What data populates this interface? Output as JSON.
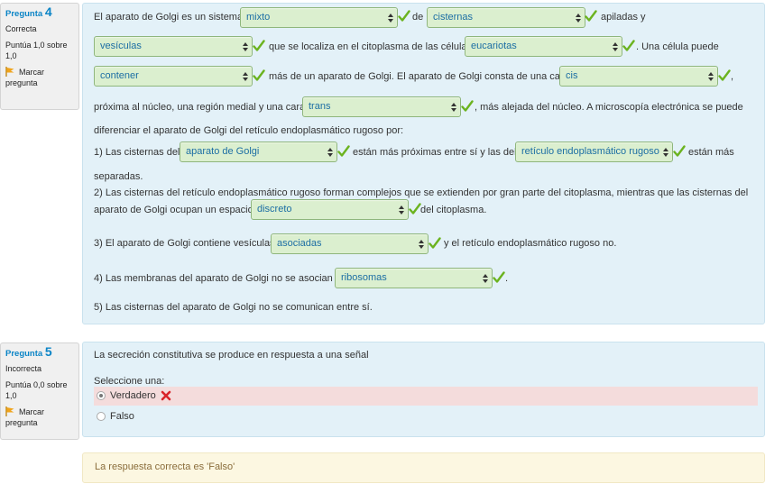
{
  "q4": {
    "number_prefix": "Pregunta",
    "number": "4",
    "state": "Correcta",
    "grade": "Puntúa 1,0 sobre 1,0",
    "flag_label": "Marcar pregunta",
    "text": {
      "t1": "El aparato de Golgi es un sistema",
      "t2": "de",
      "t3": "apiladas y",
      "t4": "que se localiza en el citoplasma de las células",
      "t5": ". Una célula puede",
      "t6": "más de un aparato de Golgi. El aparato de Golgi consta de una cara",
      "t7": ",",
      "t8": "próxima al núcleo, una región medial y una cara",
      "t9": ", más alejada del núcleo. A microscopía electrónica se puede",
      "t10": "diferenciar el aparato de Golgi del retículo endoplasmático rugoso por:",
      "t11": "1) Las cisternas del",
      "t12": "están más próximas entre sí y las del",
      "t13": "están más",
      "t14": "separadas.",
      "t15": "2) Las cisternas del retículo endoplasmático rugoso forman complejos que se extienden por gran parte del citoplasma, mientras que las cisternas del",
      "t16": "aparato de Golgi ocupan un espacio",
      "t17": "del citoplasma.",
      "t18": "3) El aparato de Golgi contiene vesículas",
      "t19": "y el retículo endoplasmático rugoso no.",
      "t20": "4) Las membranas del aparato de Golgi no se asocian a",
      "t21": ".",
      "t22": "5) Las cisternas del aparato de Golgi no se comunican entre sí."
    },
    "selects": {
      "s1": "mixto",
      "s2": "cisternas",
      "s3": "vesículas",
      "s4": "eucariotas",
      "s5": "contener",
      "s6": "cis",
      "s7": "trans",
      "s8": "aparato de Golgi",
      "s9": "retículo endoplasmático rugoso",
      "s10": "discreto",
      "s11": "asociadas",
      "s12": "ribosomas"
    }
  },
  "q5": {
    "number_prefix": "Pregunta",
    "number": "5",
    "state": "Incorrecta",
    "grade": "Puntúa 0,0 sobre 1,0",
    "flag_label": "Marcar pregunta",
    "question": "La secreción constitutiva se produce en respuesta a una señal",
    "prompt": "Seleccione una:",
    "options": [
      {
        "label": "Verdadero",
        "selected": true
      },
      {
        "label": "Falso",
        "selected": false
      }
    ],
    "feedback": "La respuesta correcta es 'Falso'"
  },
  "colors": {
    "accent": "#0a84c6",
    "select_bg": "#dbefcf",
    "check": "#6bb31f",
    "wrong_bg": "#f4dcdc",
    "x": "#d9242a"
  },
  "icons": {
    "flag": "flag-icon",
    "check": "check-icon",
    "cross": "cross-icon"
  }
}
